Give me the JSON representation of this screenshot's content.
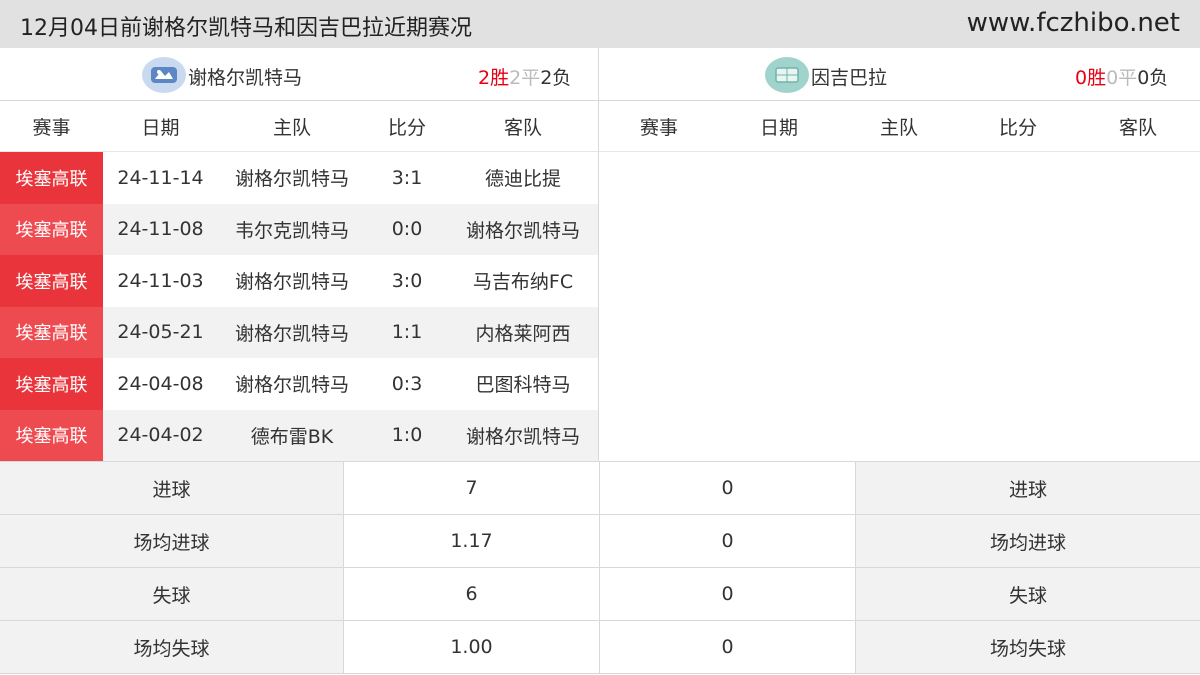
{
  "header": {
    "title": "12月04日前谢格尔凯特马和因吉巴拉近期赛况",
    "site": "www.fczhibo.net"
  },
  "left_team": {
    "name": "谢格尔凯特马",
    "logo_icon": "team-crest-icon",
    "record": {
      "wins": "2胜",
      "draws": "2平",
      "losses": "2负"
    }
  },
  "right_team": {
    "name": "因吉巴拉",
    "logo_icon": "stadium-icon",
    "record": {
      "wins": "0胜",
      "draws": "0平",
      "losses": "0负"
    }
  },
  "columns": {
    "league": "赛事",
    "date": "日期",
    "home": "主队",
    "score": "比分",
    "away": "客队"
  },
  "matches": [
    {
      "league": "埃塞高联",
      "date": "24-11-14",
      "home": "谢格尔凯特马",
      "score": "3:1",
      "away": "德迪比提"
    },
    {
      "league": "埃塞高联",
      "date": "24-11-08",
      "home": "韦尔克凯特马",
      "score": "0:0",
      "away": "谢格尔凯特马"
    },
    {
      "league": "埃塞高联",
      "date": "24-11-03",
      "home": "谢格尔凯特马",
      "score": "3:0",
      "away": "马吉布纳FC"
    },
    {
      "league": "埃塞高联",
      "date": "24-05-21",
      "home": "谢格尔凯特马",
      "score": "1:1",
      "away": "内格莱阿西"
    },
    {
      "league": "埃塞高联",
      "date": "24-04-08",
      "home": "谢格尔凯特马",
      "score": "0:3",
      "away": "巴图科特马"
    },
    {
      "league": "埃塞高联",
      "date": "24-04-02",
      "home": "德布雷BK",
      "score": "1:0",
      "away": "谢格尔凯特马"
    }
  ],
  "stats": [
    {
      "label": "进球",
      "left": "7",
      "right": "0"
    },
    {
      "label": "场均进球",
      "left": "1.17",
      "right": "0"
    },
    {
      "label": "失球",
      "left": "6",
      "right": "0"
    },
    {
      "label": "场均失球",
      "left": "1.00",
      "right": "0"
    }
  ],
  "colors": {
    "league_badge": "#e8343a",
    "win": "#e60012",
    "draw": "#bbbbbb",
    "header_bg": "#e1e1e1"
  }
}
